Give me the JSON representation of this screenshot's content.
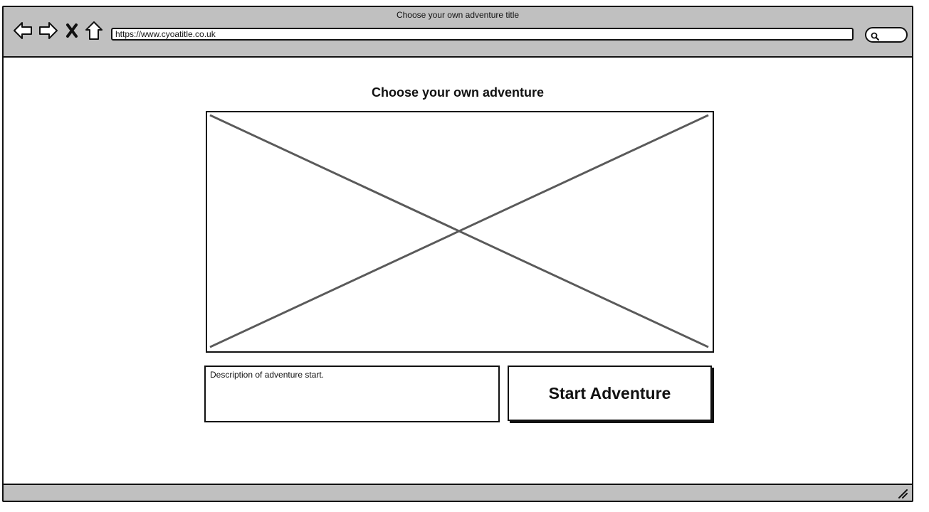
{
  "window": {
    "title": "Choose your own adventure title"
  },
  "toolbar": {
    "back_icon": "back-arrow-icon",
    "forward_icon": "forward-arrow-icon",
    "stop_icon": "close-icon",
    "home_icon": "home-icon",
    "search_icon": "search-icon"
  },
  "address_bar": {
    "url": "https://www.cyoatitle.co.uk"
  },
  "main": {
    "heading": "Choose your own adventure",
    "image_placeholder_icon": "image-placeholder",
    "description": "Description of adventure start.",
    "start_button_label": "Start Adventure"
  },
  "colors": {
    "chrome": "#c0c0c0",
    "ink": "#111111",
    "placeholder_lines": "#5a5a5a",
    "background": "#ffffff"
  }
}
